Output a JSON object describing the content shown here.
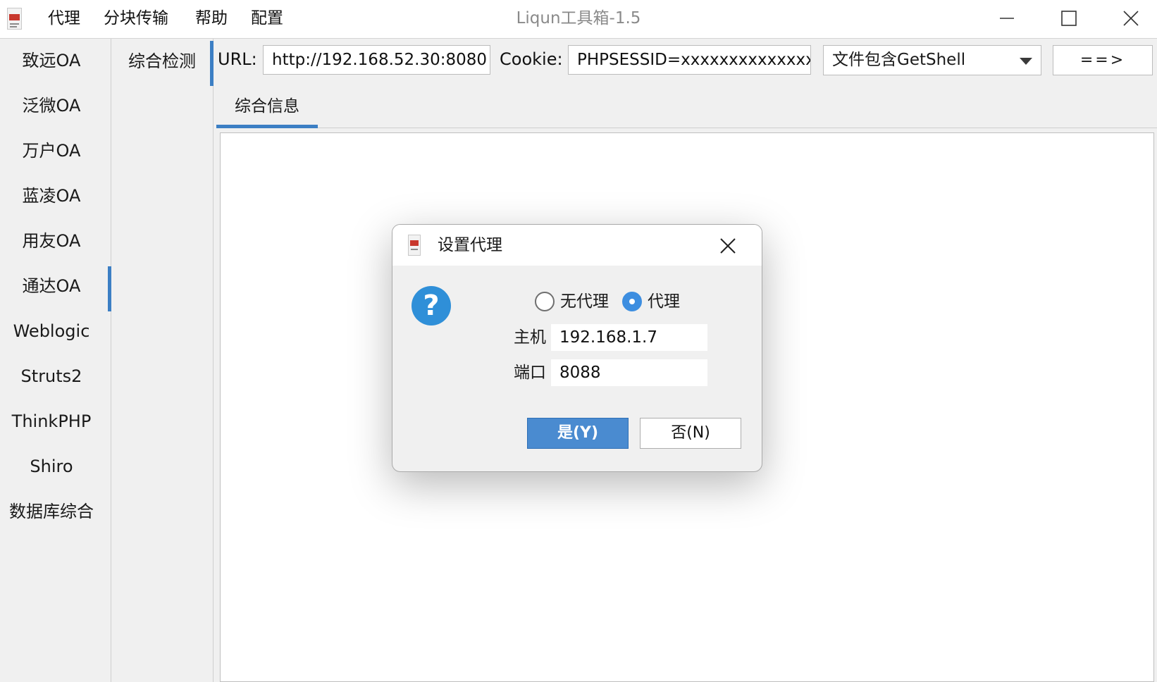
{
  "window": {
    "title": "Liqun工具箱-1.5",
    "menu": [
      "代理",
      "分块传输",
      "帮助",
      "配置"
    ]
  },
  "left_nav": {
    "items": [
      "致远OA",
      "泛微OA",
      "万户OA",
      "蓝凌OA",
      "用友OA",
      "通达OA",
      "Weblogic",
      "Struts2",
      "ThinkPHP",
      "Shiro",
      "数据库综合"
    ],
    "active": "通达OA"
  },
  "sub_nav": {
    "items": [
      "综合检测"
    ],
    "active": "综合检测"
  },
  "toolbar": {
    "url_label": "URL:",
    "url_value": "http://192.168.52.30:8080",
    "cookie_label": "Cookie:",
    "cookie_value": "PHPSESSID=xxxxxxxxxxxxxx",
    "exploit_select": "文件包含GetShell",
    "go_button": "==>"
  },
  "tabs": {
    "items": [
      "综合信息"
    ],
    "active": "综合信息"
  },
  "dialog": {
    "title": "设置代理",
    "radio_no_proxy": "无代理",
    "radio_proxy": "代理",
    "selected": "代理",
    "host_label": "主机",
    "host_value": "192.168.1.7",
    "port_label": "端口",
    "port_value": "8088",
    "yes_button": "是(Y)",
    "no_button": "否(N)"
  },
  "colors": {
    "accent": "#3c7fc4",
    "primary_button": "#4a8bd0",
    "question_icon": "#2f8fd8"
  }
}
